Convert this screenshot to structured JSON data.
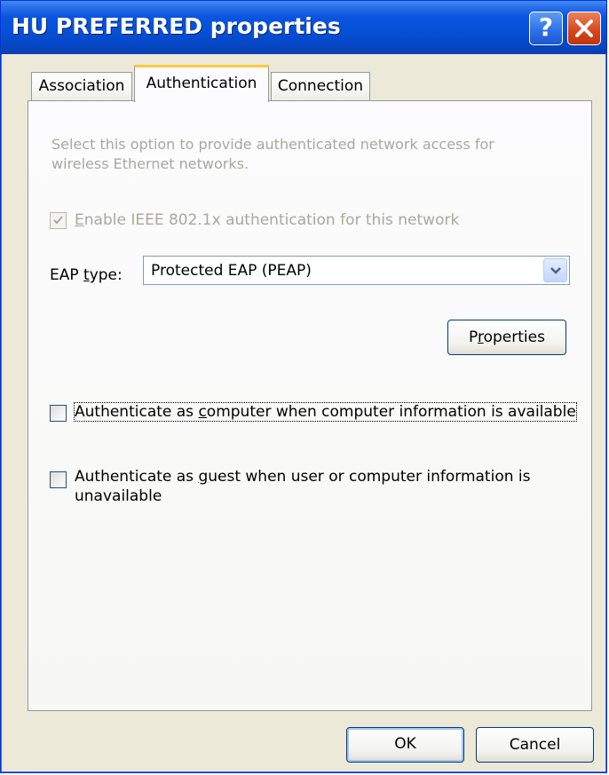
{
  "window": {
    "title": "HU PREFERRED properties",
    "help_glyph": "?",
    "close_glyph": "close-icon"
  },
  "tabs": [
    {
      "label": "Association",
      "selected": false
    },
    {
      "label": "Authentication",
      "selected": true
    },
    {
      "label": "Connection",
      "selected": false
    }
  ],
  "auth": {
    "description": "Select this option to provide authenticated network access for wireless Ethernet networks.",
    "enable_8021x": {
      "label_pre": "",
      "label_ul": "E",
      "label_post": "nable IEEE 802.1x authentication for this network",
      "checked": true,
      "disabled": true
    },
    "eap_type": {
      "label_pre": "EAP ",
      "label_ul": "t",
      "label_post": "ype:",
      "value": "Protected EAP (PEAP)"
    },
    "properties_button": {
      "pre": "P",
      "ul": "r",
      "post": "operties"
    },
    "auth_as_computer": {
      "pre": "Authenticate as ",
      "ul": "c",
      "post": "omputer when computer information is available",
      "checked": false
    },
    "auth_as_guest": {
      "pre": "Authenticate as ",
      "ul": "g",
      "post": "uest when user or computer information is unavailable",
      "checked": false
    }
  },
  "footer": {
    "ok_label": "OK",
    "cancel_label": "Cancel"
  },
  "colors": {
    "titlebar": "#0a54e0",
    "tab_highlight": "#ffc83c",
    "disabled_text": "#a9a89c"
  }
}
